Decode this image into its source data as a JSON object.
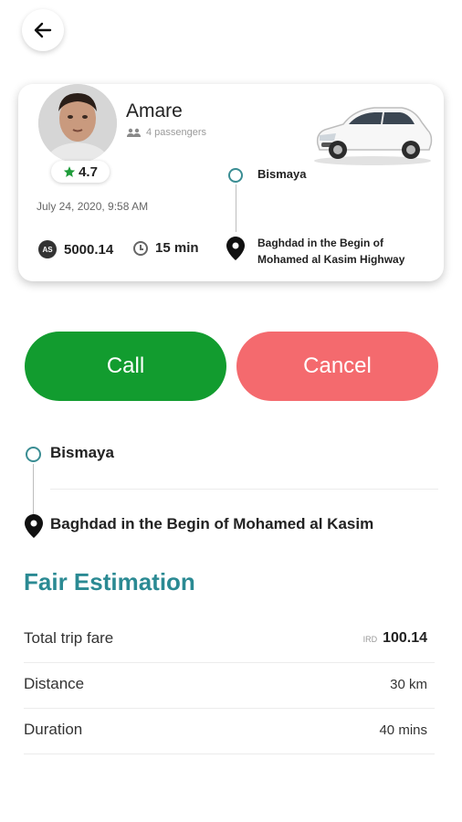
{
  "driver": {
    "name": "Amare",
    "passengers": "4 passengers",
    "rating": "4.7"
  },
  "trip": {
    "datetime": "July 24, 2020, 9:58 AM",
    "fare": "5000.14",
    "fare_icon_text": "AS",
    "duration": "15 min",
    "pickup": "Bismaya",
    "dropoff_card": "Baghdad in the Begin of Mohamed al Kasim Highway",
    "dropoff_short": "Baghdad in the Begin of Mohamed al Kasim"
  },
  "actions": {
    "call_label": "Call",
    "cancel_label": "Cancel"
  },
  "estimation": {
    "title": "Fair Estimation",
    "rows": [
      {
        "label": "Total trip fare",
        "currency": "IRD",
        "value": "100.14"
      },
      {
        "label": "Distance",
        "value": "30 km"
      },
      {
        "label": "Duration",
        "value": "40 mins"
      }
    ]
  },
  "colors": {
    "call": "#129c2f",
    "cancel": "#f46a6e",
    "accent": "#2b8a93",
    "star": "#1e9c3a"
  }
}
